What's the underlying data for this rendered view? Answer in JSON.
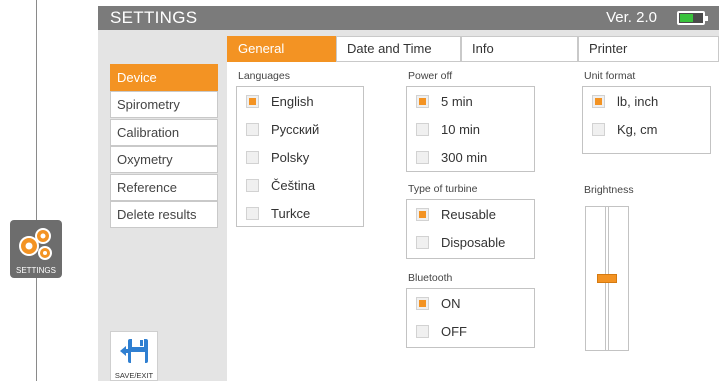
{
  "launcher": {
    "caption": "SETTINGS",
    "icon": "gears-icon"
  },
  "app": {
    "title": "SETTINGS",
    "version": "Ver. 2.0",
    "battery_icon": "battery-icon",
    "battery_level": 0.6
  },
  "menu": {
    "items": [
      {
        "label": "Device",
        "active": true
      },
      {
        "label": "Spirometry",
        "active": false
      },
      {
        "label": "Calibration",
        "active": false
      },
      {
        "label": "Oxymetry",
        "active": false
      },
      {
        "label": "Reference",
        "active": false
      },
      {
        "label": "Delete results",
        "active": false
      }
    ],
    "save_label": "SAVE/EXIT",
    "save_icon": "floppy-disk-icon"
  },
  "tabs": [
    {
      "label": "General",
      "active": true
    },
    {
      "label": "Date and Time",
      "active": false
    },
    {
      "label": "Info",
      "active": false
    },
    {
      "label": "Printer",
      "active": false
    }
  ],
  "general": {
    "languages": {
      "label": "Languages",
      "options": [
        {
          "label": "English",
          "checked": true
        },
        {
          "label": "Русский",
          "checked": false
        },
        {
          "label": "Polsky",
          "checked": false
        },
        {
          "label": "Čeština",
          "checked": false
        },
        {
          "label": "Turkce",
          "checked": false
        }
      ]
    },
    "power_off": {
      "label": "Power off",
      "options": [
        {
          "label": "5 min",
          "checked": true
        },
        {
          "label": "10 min",
          "checked": false
        },
        {
          "label": "300 min",
          "checked": false
        }
      ]
    },
    "unit_format": {
      "label": "Unit format",
      "options": [
        {
          "label": "lb, inch",
          "checked": true
        },
        {
          "label": "Kg, cm",
          "checked": false
        }
      ]
    },
    "turbine": {
      "label": "Type of turbine",
      "options": [
        {
          "label": "Reusable",
          "checked": true
        },
        {
          "label": "Disposable",
          "checked": false
        }
      ]
    },
    "bluetooth": {
      "label": "Bluetooth",
      "options": [
        {
          "label": "ON",
          "checked": true
        },
        {
          "label": "OFF",
          "checked": false
        }
      ]
    },
    "brightness": {
      "label": "Brightness",
      "level": 0.5
    }
  },
  "colors": {
    "accent": "#f39323",
    "titlebar": "#7b7b7b",
    "battery": "#39c23c"
  }
}
